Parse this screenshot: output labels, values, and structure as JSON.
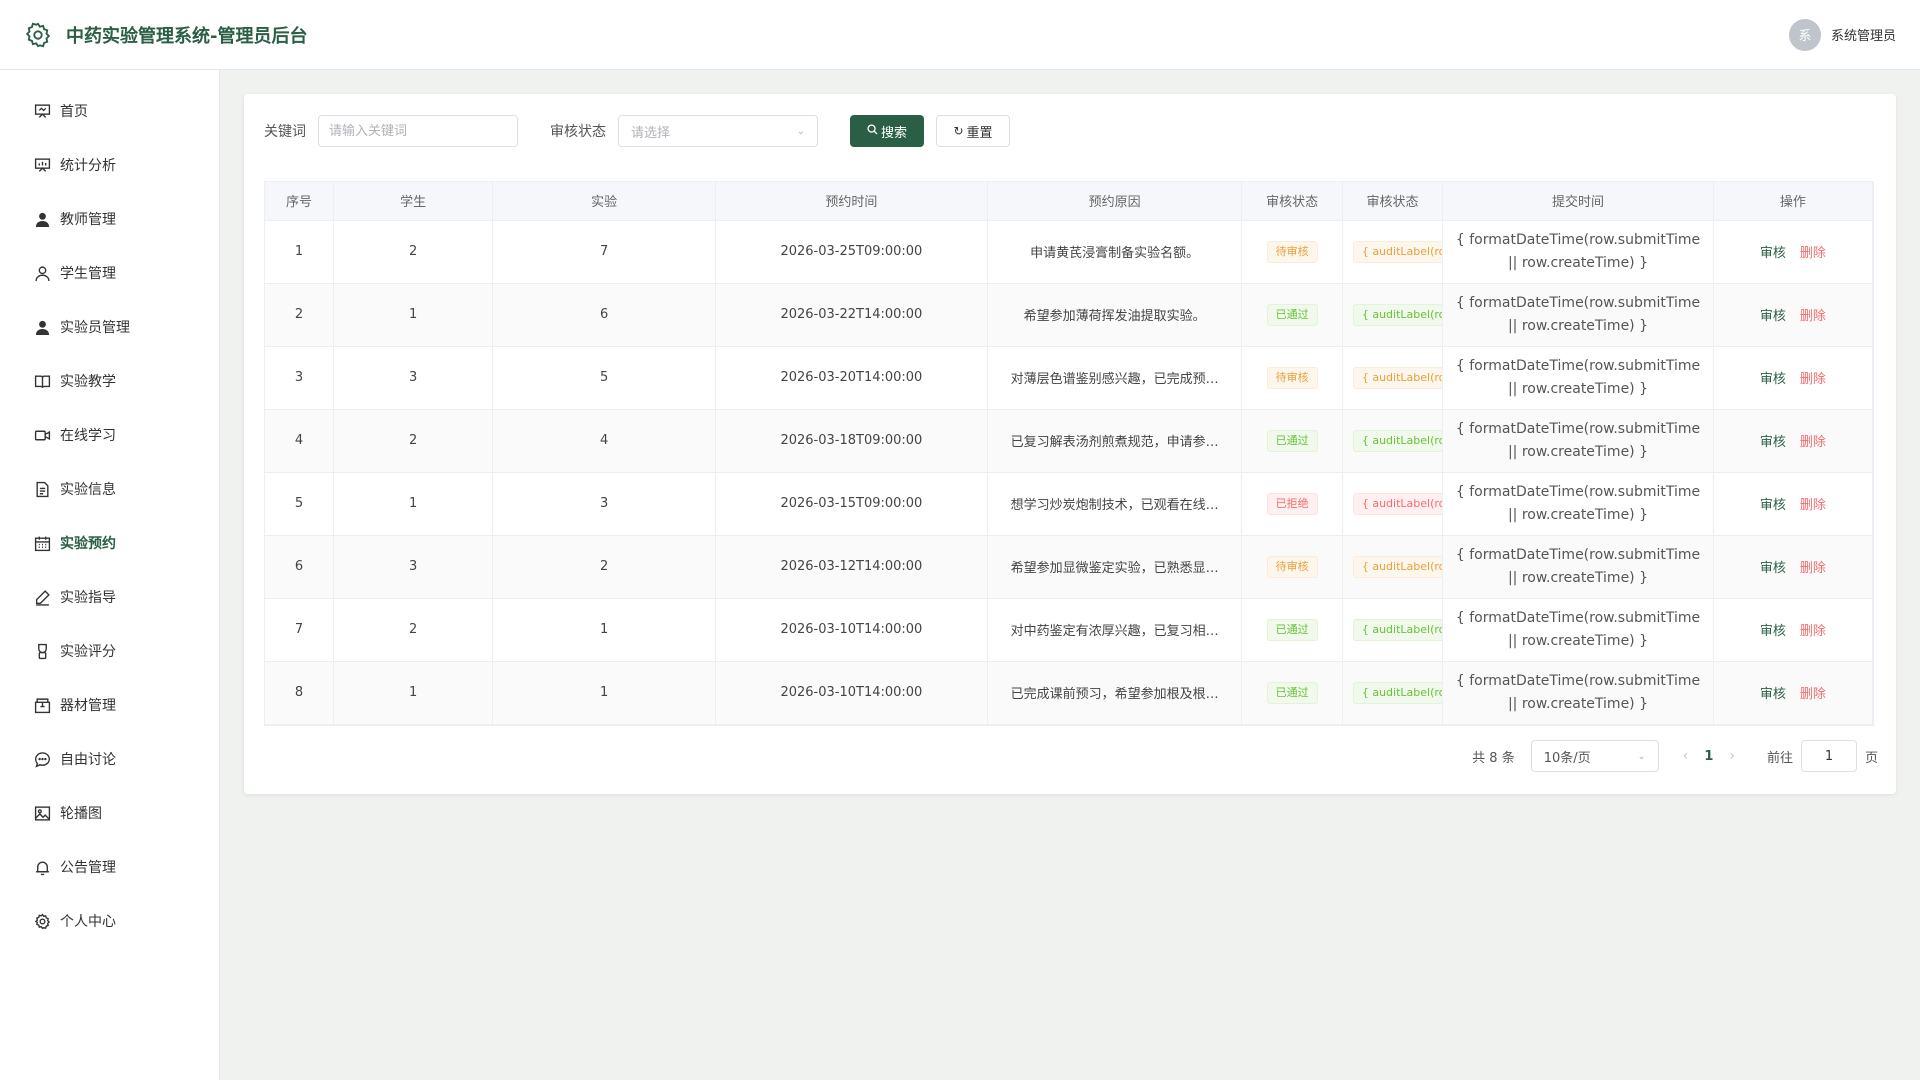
{
  "header": {
    "title": "中药实验管理系统-管理员后台",
    "avatar_text": "系",
    "username": "系统管理员"
  },
  "sidebar": {
    "items": [
      {
        "label": "首页",
        "icon": "presentation-icon"
      },
      {
        "label": "统计分析",
        "icon": "chart-board-icon"
      },
      {
        "label": "教师管理",
        "icon": "user-filled-icon"
      },
      {
        "label": "学生管理",
        "icon": "user-outline-icon"
      },
      {
        "label": "实验员管理",
        "icon": "user-filled-icon"
      },
      {
        "label": "实验教学",
        "icon": "book-icon"
      },
      {
        "label": "在线学习",
        "icon": "video-camera-icon"
      },
      {
        "label": "实验信息",
        "icon": "document-icon"
      },
      {
        "label": "实验预约",
        "icon": "calendar-icon"
      },
      {
        "label": "实验指导",
        "icon": "edit-pen-icon"
      },
      {
        "label": "实验评分",
        "icon": "medal-icon"
      },
      {
        "label": "器材管理",
        "icon": "box-icon"
      },
      {
        "label": "自由讨论",
        "icon": "chat-icon"
      },
      {
        "label": "轮播图",
        "icon": "picture-icon"
      },
      {
        "label": "公告管理",
        "icon": "bell-icon"
      },
      {
        "label": "个人中心",
        "icon": "gear-icon"
      }
    ],
    "active_index": 8
  },
  "filter": {
    "keyword_label": "关键词",
    "keyword_placeholder": "请输入关键词",
    "keyword_value": "",
    "status_label": "审核状态",
    "status_placeholder": "请选择",
    "search_label": "搜索",
    "reset_label": "重置"
  },
  "table": {
    "columns": [
      "序号",
      "学生",
      "实验",
      "预约时间",
      "预约原因",
      "审核状态",
      "审核状态",
      "提交时间",
      "操作"
    ],
    "rows": [
      {
        "index": "1",
        "student": "2",
        "experiment": "7",
        "time": "2026-03-25T09:00:00",
        "reason": "申请黄芪浸膏制备实验名额。",
        "status": "待审核",
        "status_type": "pending",
        "raw_status": "{ auditLabel(row.auditStatus) }",
        "submit": "{ formatDateTime(row.submitTime || row.createTime) }",
        "audit": "审核",
        "delete": "删除"
      },
      {
        "index": "2",
        "student": "1",
        "experiment": "6",
        "time": "2026-03-22T14:00:00",
        "reason": "希望参加薄荷挥发油提取实验。",
        "status": "已通过",
        "status_type": "pass",
        "raw_status": "{ auditLabel(row.auditStatus) }",
        "submit": "{ formatDateTime(row.submitTime || row.createTime) }",
        "audit": "审核",
        "delete": "删除"
      },
      {
        "index": "3",
        "student": "3",
        "experiment": "5",
        "time": "2026-03-20T14:00:00",
        "reason": "对薄层色谱鉴别感兴趣，已完成预…",
        "status": "待审核",
        "status_type": "pending",
        "raw_status": "{ auditLabel(row.auditStatus) }",
        "submit": "{ formatDateTime(row.submitTime || row.createTime) }",
        "audit": "审核",
        "delete": "删除"
      },
      {
        "index": "4",
        "student": "2",
        "experiment": "4",
        "time": "2026-03-18T09:00:00",
        "reason": "已复习解表汤剂煎煮规范，申请参…",
        "status": "已通过",
        "status_type": "pass",
        "raw_status": "{ auditLabel(row.auditStatus) }",
        "submit": "{ formatDateTime(row.submitTime || row.createTime) }",
        "audit": "审核",
        "delete": "删除"
      },
      {
        "index": "5",
        "student": "1",
        "experiment": "3",
        "time": "2026-03-15T09:00:00",
        "reason": "想学习炒炭炮制技术，已观看在线…",
        "status": "已拒绝",
        "status_type": "reject",
        "raw_status": "{ auditLabel(row.auditStatus) }",
        "submit": "{ formatDateTime(row.submitTime || row.createTime) }",
        "audit": "审核",
        "delete": "删除"
      },
      {
        "index": "6",
        "student": "3",
        "experiment": "2",
        "time": "2026-03-12T14:00:00",
        "reason": "希望参加显微鉴定实验，已熟悉显…",
        "status": "待审核",
        "status_type": "pending",
        "raw_status": "{ auditLabel(row.auditStatus) }",
        "submit": "{ formatDateTime(row.submitTime || row.createTime) }",
        "audit": "审核",
        "delete": "删除"
      },
      {
        "index": "7",
        "student": "2",
        "experiment": "1",
        "time": "2026-03-10T14:00:00",
        "reason": "对中药鉴定有浓厚兴趣，已复习相…",
        "status": "已通过",
        "status_type": "pass",
        "raw_status": "{ auditLabel(row.auditStatus) }",
        "submit": "{ formatDateTime(row.submitTime || row.createTime) }",
        "audit": "审核",
        "delete": "删除"
      },
      {
        "index": "8",
        "student": "1",
        "experiment": "1",
        "time": "2026-03-10T14:00:00",
        "reason": "已完成课前预习，希望参加根及根…",
        "status": "已通过",
        "status_type": "pass",
        "raw_status": "{ auditLabel(row.auditStatus) }",
        "submit": "{ formatDateTime(row.submitTime || row.createTime) }",
        "audit": "审核",
        "delete": "删除"
      }
    ]
  },
  "pagination": {
    "total_text": "共 8 条",
    "page_size": "10条/页",
    "current_page": "1",
    "goto_label": "前往",
    "goto_value": "1",
    "page_suffix": "页"
  },
  "colors": {
    "brand": "#2b5f45",
    "danger": "#f56c6c",
    "pending": "#e6a23c",
    "pass": "#67c23a"
  }
}
